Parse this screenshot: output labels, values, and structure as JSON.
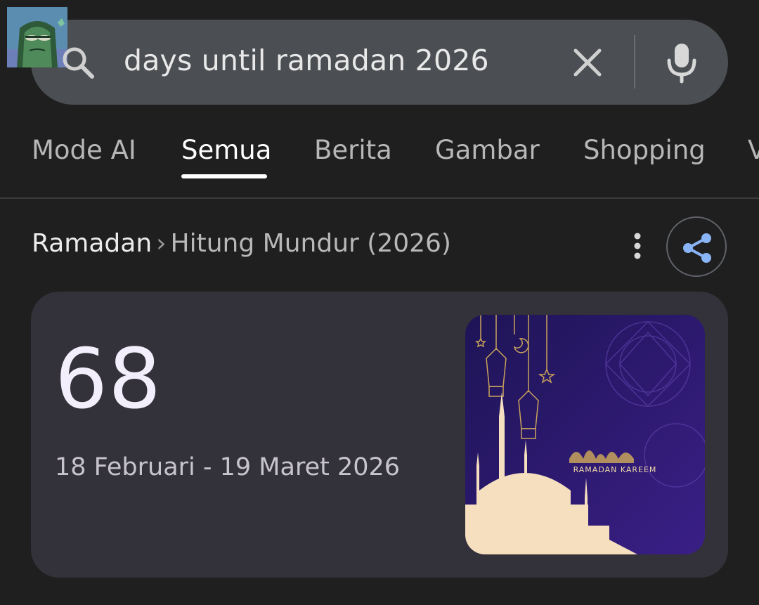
{
  "search": {
    "query": "days until ramadan 2026"
  },
  "tabs": [
    {
      "label": "Mode AI",
      "active": false
    },
    {
      "label": "Semua",
      "active": true
    },
    {
      "label": "Berita",
      "active": false
    },
    {
      "label": "Gambar",
      "active": false
    },
    {
      "label": "Shopping",
      "active": false
    },
    {
      "label": "V",
      "active": false
    }
  ],
  "breadcrumb": {
    "root": "Ramadan",
    "separator": "›",
    "current": "Hitung Mundur (2026)"
  },
  "result": {
    "days_count": "68",
    "date_range": "18 Februari - 19 Maret 2026",
    "image_caption": "RAMADAN KAREEM"
  },
  "icons": {
    "search": "search-icon",
    "clear": "close-icon",
    "mic": "microphone-icon",
    "more": "more-vert-icon",
    "share": "share-icon"
  },
  "colors": {
    "background": "#1f1f1f",
    "search_bar": "#4b4e53",
    "card": "#333139",
    "share_icon": "#8ab4f8",
    "image_bg": "#2a1a6b",
    "mosque": "#f6dfbf"
  }
}
